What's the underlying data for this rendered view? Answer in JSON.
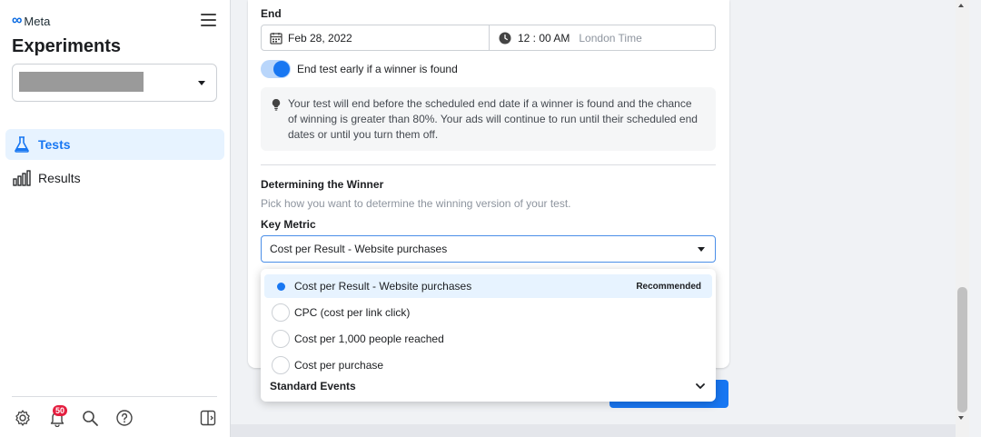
{
  "brand": {
    "logo_text": "Meta",
    "accent": "#1877f2"
  },
  "sidebar": {
    "title": "Experiments",
    "nav": [
      {
        "label": "Tests",
        "icon": "flask-icon",
        "active": true
      },
      {
        "label": "Results",
        "icon": "bar-chart-icon",
        "active": false
      }
    ],
    "footer": {
      "notification_count": "50",
      "icons": [
        "settings-icon",
        "bell-icon",
        "search-icon",
        "help-icon",
        "panel-toggle-icon"
      ]
    }
  },
  "end": {
    "label": "End",
    "date": "Feb 28, 2022",
    "time": "12 : 00 AM",
    "timezone": "London Time",
    "toggle_label": "End test early if a winner is found",
    "toggle_on": true,
    "info": "Your test will end before the scheduled end date if a winner is found and the chance of winning is greater than 80%. Your ads will continue to run until their scheduled end dates or until you turn them off."
  },
  "winner": {
    "title": "Determining the Winner",
    "subtitle": "Pick how you want to determine the winning version of your test.",
    "metric_label": "Key Metric",
    "selected": "Cost per Result - Website purchases",
    "options": [
      {
        "label": "Cost per Result - Website purchases",
        "badge": "Recommended",
        "selected": true
      },
      {
        "label": "CPC (cost per link click)",
        "badge": "",
        "selected": false
      },
      {
        "label": "Cost per 1,000 people reached",
        "badge": "",
        "selected": false
      },
      {
        "label": "Cost per purchase",
        "badge": "",
        "selected": false
      }
    ],
    "standard_events": "Standard Events"
  }
}
